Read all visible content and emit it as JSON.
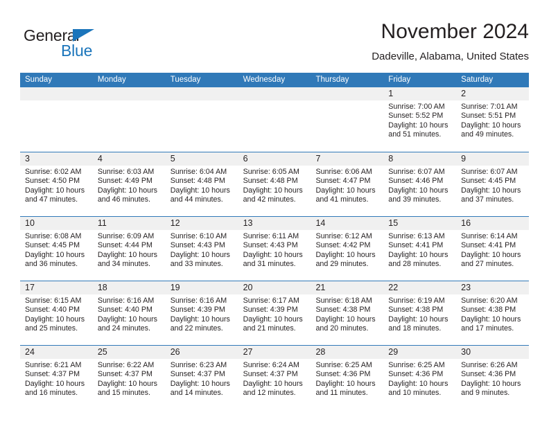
{
  "brand": {
    "name_top": "General",
    "name_bottom": "Blue",
    "accent_color": "#1b75bb",
    "triangle_icon": "triangle-logo-icon"
  },
  "header": {
    "title": "November 2024",
    "subtitle": "Dadeville, Alabama, United States"
  },
  "theme": {
    "header_blue": "#3079b8",
    "band_gray": "#f0f0f0",
    "text": "#231f20"
  },
  "weekdays": [
    "Sunday",
    "Monday",
    "Tuesday",
    "Wednesday",
    "Thursday",
    "Friday",
    "Saturday"
  ],
  "weeks": [
    [
      {
        "day": "",
        "sunrise": "",
        "sunset": "",
        "daylight_line1": "",
        "daylight_line2": "",
        "empty": true
      },
      {
        "day": "",
        "sunrise": "",
        "sunset": "",
        "daylight_line1": "",
        "daylight_line2": "",
        "empty": true
      },
      {
        "day": "",
        "sunrise": "",
        "sunset": "",
        "daylight_line1": "",
        "daylight_line2": "",
        "empty": true
      },
      {
        "day": "",
        "sunrise": "",
        "sunset": "",
        "daylight_line1": "",
        "daylight_line2": "",
        "empty": true
      },
      {
        "day": "",
        "sunrise": "",
        "sunset": "",
        "daylight_line1": "",
        "daylight_line2": "",
        "empty": true
      },
      {
        "day": "1",
        "sunrise": "Sunrise: 7:00 AM",
        "sunset": "Sunset: 5:52 PM",
        "daylight_line1": "Daylight: 10 hours",
        "daylight_line2": "and 51 minutes.",
        "empty": false
      },
      {
        "day": "2",
        "sunrise": "Sunrise: 7:01 AM",
        "sunset": "Sunset: 5:51 PM",
        "daylight_line1": "Daylight: 10 hours",
        "daylight_line2": "and 49 minutes.",
        "empty": false
      }
    ],
    [
      {
        "day": "3",
        "sunrise": "Sunrise: 6:02 AM",
        "sunset": "Sunset: 4:50 PM",
        "daylight_line1": "Daylight: 10 hours",
        "daylight_line2": "and 47 minutes.",
        "empty": false
      },
      {
        "day": "4",
        "sunrise": "Sunrise: 6:03 AM",
        "sunset": "Sunset: 4:49 PM",
        "daylight_line1": "Daylight: 10 hours",
        "daylight_line2": "and 46 minutes.",
        "empty": false
      },
      {
        "day": "5",
        "sunrise": "Sunrise: 6:04 AM",
        "sunset": "Sunset: 4:48 PM",
        "daylight_line1": "Daylight: 10 hours",
        "daylight_line2": "and 44 minutes.",
        "empty": false
      },
      {
        "day": "6",
        "sunrise": "Sunrise: 6:05 AM",
        "sunset": "Sunset: 4:48 PM",
        "daylight_line1": "Daylight: 10 hours",
        "daylight_line2": "and 42 minutes.",
        "empty": false
      },
      {
        "day": "7",
        "sunrise": "Sunrise: 6:06 AM",
        "sunset": "Sunset: 4:47 PM",
        "daylight_line1": "Daylight: 10 hours",
        "daylight_line2": "and 41 minutes.",
        "empty": false
      },
      {
        "day": "8",
        "sunrise": "Sunrise: 6:07 AM",
        "sunset": "Sunset: 4:46 PM",
        "daylight_line1": "Daylight: 10 hours",
        "daylight_line2": "and 39 minutes.",
        "empty": false
      },
      {
        "day": "9",
        "sunrise": "Sunrise: 6:07 AM",
        "sunset": "Sunset: 4:45 PM",
        "daylight_line1": "Daylight: 10 hours",
        "daylight_line2": "and 37 minutes.",
        "empty": false
      }
    ],
    [
      {
        "day": "10",
        "sunrise": "Sunrise: 6:08 AM",
        "sunset": "Sunset: 4:45 PM",
        "daylight_line1": "Daylight: 10 hours",
        "daylight_line2": "and 36 minutes.",
        "empty": false
      },
      {
        "day": "11",
        "sunrise": "Sunrise: 6:09 AM",
        "sunset": "Sunset: 4:44 PM",
        "daylight_line1": "Daylight: 10 hours",
        "daylight_line2": "and 34 minutes.",
        "empty": false
      },
      {
        "day": "12",
        "sunrise": "Sunrise: 6:10 AM",
        "sunset": "Sunset: 4:43 PM",
        "daylight_line1": "Daylight: 10 hours",
        "daylight_line2": "and 33 minutes.",
        "empty": false
      },
      {
        "day": "13",
        "sunrise": "Sunrise: 6:11 AM",
        "sunset": "Sunset: 4:43 PM",
        "daylight_line1": "Daylight: 10 hours",
        "daylight_line2": "and 31 minutes.",
        "empty": false
      },
      {
        "day": "14",
        "sunrise": "Sunrise: 6:12 AM",
        "sunset": "Sunset: 4:42 PM",
        "daylight_line1": "Daylight: 10 hours",
        "daylight_line2": "and 29 minutes.",
        "empty": false
      },
      {
        "day": "15",
        "sunrise": "Sunrise: 6:13 AM",
        "sunset": "Sunset: 4:41 PM",
        "daylight_line1": "Daylight: 10 hours",
        "daylight_line2": "and 28 minutes.",
        "empty": false
      },
      {
        "day": "16",
        "sunrise": "Sunrise: 6:14 AM",
        "sunset": "Sunset: 4:41 PM",
        "daylight_line1": "Daylight: 10 hours",
        "daylight_line2": "and 27 minutes.",
        "empty": false
      }
    ],
    [
      {
        "day": "17",
        "sunrise": "Sunrise: 6:15 AM",
        "sunset": "Sunset: 4:40 PM",
        "daylight_line1": "Daylight: 10 hours",
        "daylight_line2": "and 25 minutes.",
        "empty": false
      },
      {
        "day": "18",
        "sunrise": "Sunrise: 6:16 AM",
        "sunset": "Sunset: 4:40 PM",
        "daylight_line1": "Daylight: 10 hours",
        "daylight_line2": "and 24 minutes.",
        "empty": false
      },
      {
        "day": "19",
        "sunrise": "Sunrise: 6:16 AM",
        "sunset": "Sunset: 4:39 PM",
        "daylight_line1": "Daylight: 10 hours",
        "daylight_line2": "and 22 minutes.",
        "empty": false
      },
      {
        "day": "20",
        "sunrise": "Sunrise: 6:17 AM",
        "sunset": "Sunset: 4:39 PM",
        "daylight_line1": "Daylight: 10 hours",
        "daylight_line2": "and 21 minutes.",
        "empty": false
      },
      {
        "day": "21",
        "sunrise": "Sunrise: 6:18 AM",
        "sunset": "Sunset: 4:38 PM",
        "daylight_line1": "Daylight: 10 hours",
        "daylight_line2": "and 20 minutes.",
        "empty": false
      },
      {
        "day": "22",
        "sunrise": "Sunrise: 6:19 AM",
        "sunset": "Sunset: 4:38 PM",
        "daylight_line1": "Daylight: 10 hours",
        "daylight_line2": "and 18 minutes.",
        "empty": false
      },
      {
        "day": "23",
        "sunrise": "Sunrise: 6:20 AM",
        "sunset": "Sunset: 4:38 PM",
        "daylight_line1": "Daylight: 10 hours",
        "daylight_line2": "and 17 minutes.",
        "empty": false
      }
    ],
    [
      {
        "day": "24",
        "sunrise": "Sunrise: 6:21 AM",
        "sunset": "Sunset: 4:37 PM",
        "daylight_line1": "Daylight: 10 hours",
        "daylight_line2": "and 16 minutes.",
        "empty": false
      },
      {
        "day": "25",
        "sunrise": "Sunrise: 6:22 AM",
        "sunset": "Sunset: 4:37 PM",
        "daylight_line1": "Daylight: 10 hours",
        "daylight_line2": "and 15 minutes.",
        "empty": false
      },
      {
        "day": "26",
        "sunrise": "Sunrise: 6:23 AM",
        "sunset": "Sunset: 4:37 PM",
        "daylight_line1": "Daylight: 10 hours",
        "daylight_line2": "and 14 minutes.",
        "empty": false
      },
      {
        "day": "27",
        "sunrise": "Sunrise: 6:24 AM",
        "sunset": "Sunset: 4:37 PM",
        "daylight_line1": "Daylight: 10 hours",
        "daylight_line2": "and 12 minutes.",
        "empty": false
      },
      {
        "day": "28",
        "sunrise": "Sunrise: 6:25 AM",
        "sunset": "Sunset: 4:36 PM",
        "daylight_line1": "Daylight: 10 hours",
        "daylight_line2": "and 11 minutes.",
        "empty": false
      },
      {
        "day": "29",
        "sunrise": "Sunrise: 6:25 AM",
        "sunset": "Sunset: 4:36 PM",
        "daylight_line1": "Daylight: 10 hours",
        "daylight_line2": "and 10 minutes.",
        "empty": false
      },
      {
        "day": "30",
        "sunrise": "Sunrise: 6:26 AM",
        "sunset": "Sunset: 4:36 PM",
        "daylight_line1": "Daylight: 10 hours",
        "daylight_line2": "and 9 minutes.",
        "empty": false
      }
    ]
  ]
}
